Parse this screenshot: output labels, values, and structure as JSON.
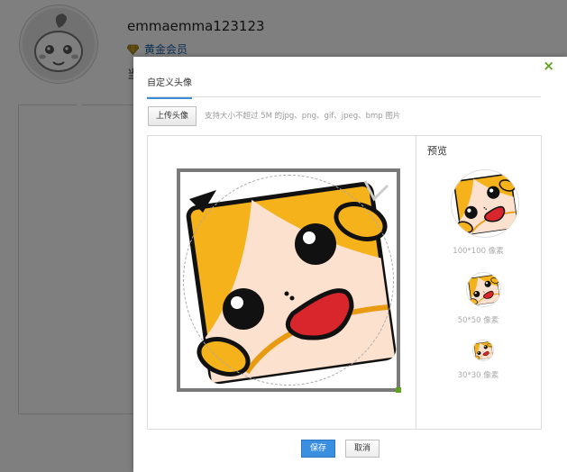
{
  "profile": {
    "username": "emmaemma123123",
    "member_label": "黄金会员",
    "truncated_text": "当"
  },
  "dialog": {
    "close_glyph": "×",
    "tab_label": "自定义头像",
    "upload_button": "上传头像",
    "upload_hint": "支持大小不超过 5M 的jpg、png、gif、jpeg、bmp 图片",
    "preview_title": "预览",
    "preview_sizes": [
      "100*100 像素",
      "50*50 像素",
      "30*30 像素"
    ],
    "save_button": "保存",
    "cancel_button": "取消"
  },
  "colors": {
    "accent_blue": "#3a8fe0",
    "close_green": "#5ea31b",
    "member_gold": "#c9a227",
    "monkey_yellow": "#f5b21a"
  }
}
